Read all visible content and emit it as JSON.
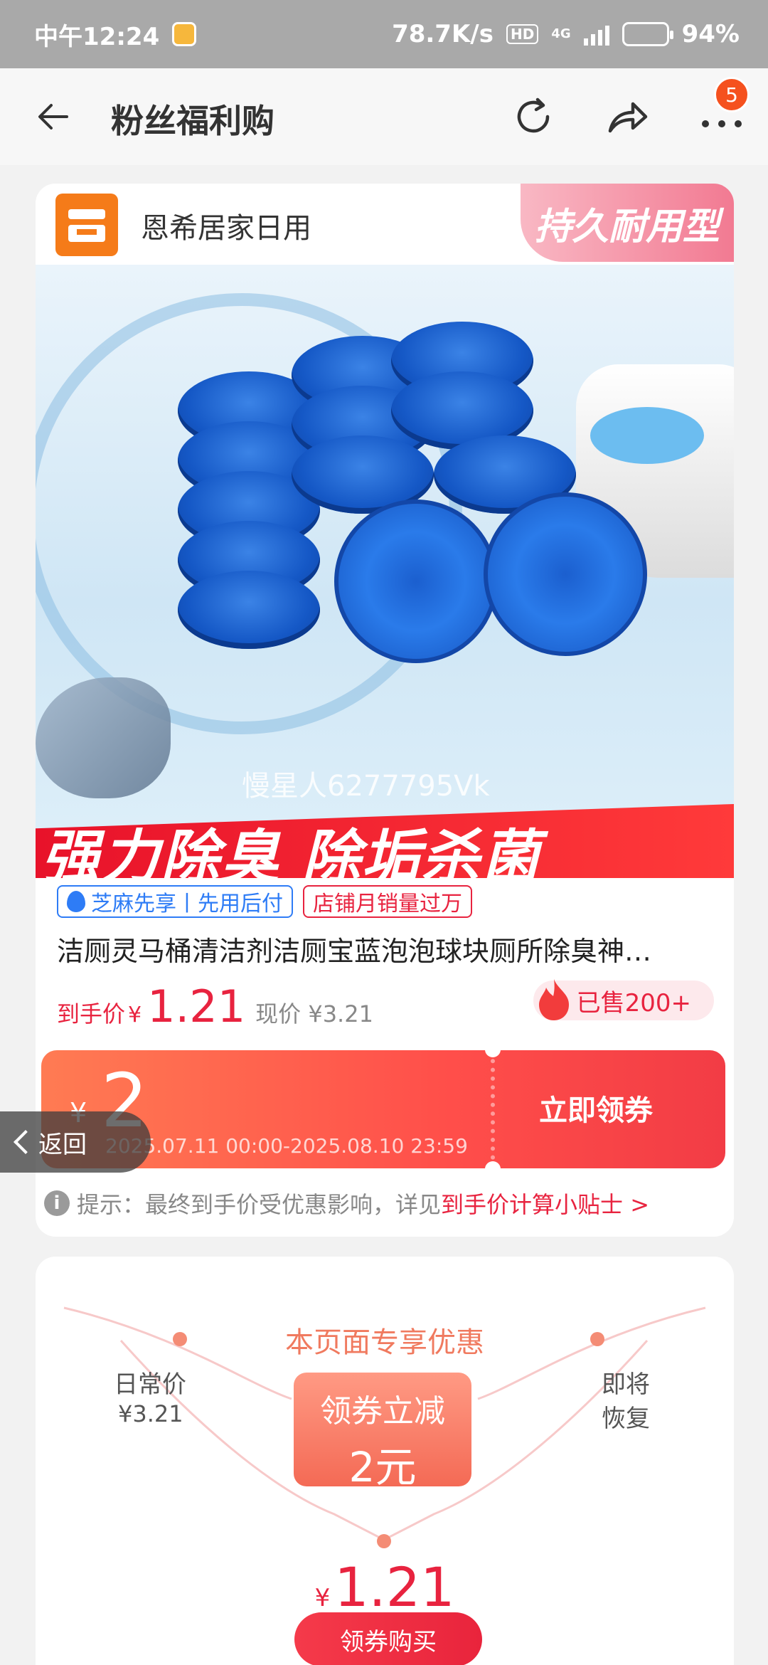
{
  "status_bar": {
    "time": "中午12:24",
    "network_speed": "78.7K/s",
    "hd": "HD",
    "network_type": "4G",
    "battery": "94%",
    "battery_level": 0.94
  },
  "nav": {
    "title": "粉丝福利购",
    "notification_count": "5",
    "icons": [
      "back-arrow-icon",
      "refresh-icon",
      "share-icon",
      "more-icon"
    ]
  },
  "shop": {
    "name": "恩希居家日用",
    "tag": "持久耐用型"
  },
  "product_image": {
    "watermark": "慢星人6277795Vk",
    "banner": "强力除臭 除垢杀菌"
  },
  "tags": {
    "zhima": "芝麻先享丨先用后付",
    "sales": "店铺月销量过万"
  },
  "product": {
    "title": "洁厕灵马桶清洁剂洁厕宝蓝泡泡球块厕所除臭神…",
    "price_label": "到手价",
    "currency": "¥",
    "final_price": "1.21",
    "current_price": "现价 ¥3.21",
    "sold": "已售200+"
  },
  "coupon": {
    "currency": "¥",
    "amount": "2",
    "validity": "2025.07.11 00:00-2025.08.10 23:59",
    "button": "立即领券"
  },
  "back_float": {
    "label": "返回"
  },
  "tip": {
    "text": "提示：最终到手价受优惠影响，详见",
    "link": "到手价计算小贴士 >"
  },
  "promo": {
    "title": "本页面专享优惠",
    "daily_label": "日常价",
    "daily_price": "¥3.21",
    "restore_line1": "即将",
    "restore_line2": "恢复",
    "box_line1": "领券立减",
    "box_line2": "2元",
    "final_currency": "¥",
    "final_price": "1.21",
    "buy_button": "领券购买"
  },
  "colors": {
    "accent": "#e8233f",
    "coupon_orange": "#ff7b53",
    "shop_orange": "#f57b19",
    "status_bar": "#a9a9a9"
  }
}
